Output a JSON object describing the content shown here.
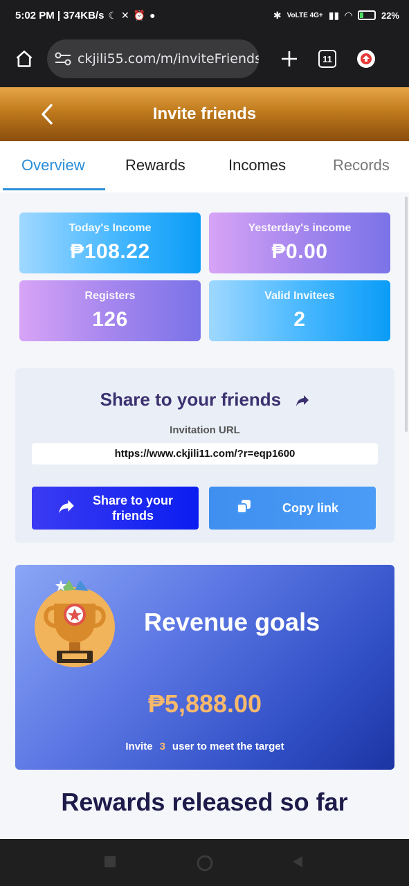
{
  "status_bar": {
    "time_speed": "5:02 PM | 374KB/s",
    "battery": "22%",
    "battery_level": 0.22,
    "network_glyphs": "VoLTE 4G+"
  },
  "browser": {
    "url": "ckjili55.com/m/inviteFriends",
    "tab_count": "11"
  },
  "header": {
    "title": "Invite friends"
  },
  "tabs": [
    {
      "label": "Overview",
      "active": true
    },
    {
      "label": "Rewards",
      "active": false
    },
    {
      "label": "Incomes",
      "active": false
    },
    {
      "label": "Records",
      "active": false
    }
  ],
  "stats": [
    {
      "label": "Today's Income",
      "value": "₱108.22",
      "theme": "blue"
    },
    {
      "label": "Yesterday's income",
      "value": "₱0.00",
      "theme": "purple"
    },
    {
      "label": "Registers",
      "value": "126",
      "theme": "purple"
    },
    {
      "label": "Valid Invitees",
      "value": "2",
      "theme": "blue"
    }
  ],
  "share": {
    "heading": "Share to your friends",
    "url_label": "Invitation URL",
    "url_value": "https://www.ckjili11.com/?r=eqp1600",
    "share_button": "Share to your friends",
    "copy_button": "Copy link"
  },
  "revenue": {
    "title": "Revenue goals",
    "amount": "₱5,888.00",
    "note_before": "Invite",
    "note_count": "3",
    "note_after": "user to meet the target"
  },
  "released_heading": "Rewards released so far",
  "colors": {
    "accent": "#2a8ed8",
    "header_gold": "#c07a1c",
    "amount_gold": "#f7b96c",
    "share_blue": "#0a1df0"
  }
}
